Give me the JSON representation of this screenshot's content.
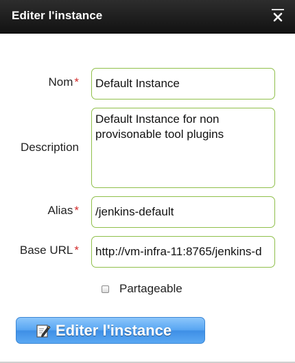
{
  "dialog": {
    "title": "Editer l'instance",
    "close_icon": "close-icon"
  },
  "form": {
    "required_marker": "*",
    "name": {
      "label": "Nom",
      "value": "Default Instance"
    },
    "description": {
      "label": "Description",
      "value": "Default Instance for non provisonable tool plugins"
    },
    "alias": {
      "label": "Alias",
      "value": "/jenkins-default"
    },
    "base_url": {
      "label": "Base URL",
      "value": "http://vm-infra-11:8765/jenkins-d"
    },
    "shareable": {
      "label": "Partageable",
      "checked": false
    },
    "submit": {
      "label": "Editer l'instance",
      "icon": "edit-icon"
    }
  },
  "colors": {
    "titlebar": "#1b1b1b",
    "field_border": "#8fbf4a",
    "required": "#d22a2a",
    "button": "#4a9bee"
  }
}
